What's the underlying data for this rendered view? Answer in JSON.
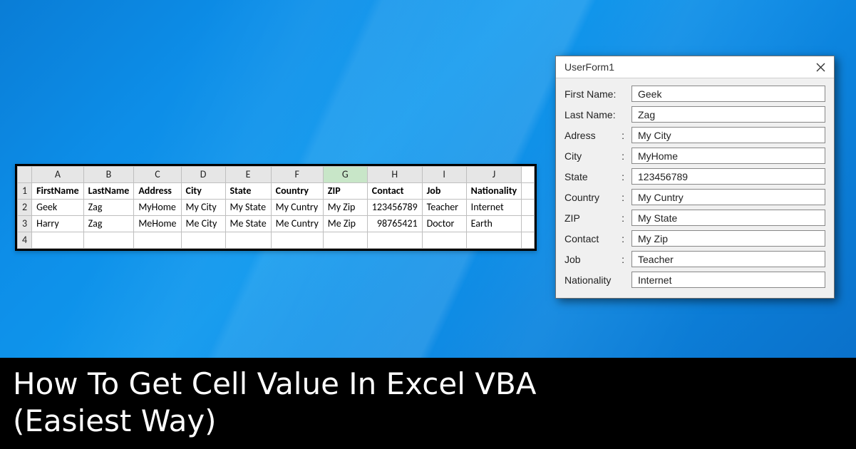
{
  "spreadsheet": {
    "columns": [
      "A",
      "B",
      "C",
      "D",
      "E",
      "F",
      "G",
      "H",
      "I",
      "J"
    ],
    "selectedColumn": "G",
    "headers": [
      "FirstName",
      "LastName",
      "Address",
      "City",
      "State",
      "Country",
      "ZIP",
      "Contact",
      "Job",
      "Nationality"
    ],
    "rows": [
      {
        "num": "2",
        "cells": [
          "Geek",
          "Zag",
          "MyHome",
          "My City",
          "My State",
          "My Cuntry",
          "My Zip",
          "123456789",
          "Teacher",
          "Internet"
        ]
      },
      {
        "num": "3",
        "cells": [
          "Harry",
          "Zag",
          "MeHome",
          "Me City",
          "Me State",
          "Me Cuntry",
          "Me Zip",
          "98765421",
          "Doctor",
          "Earth"
        ]
      }
    ],
    "emptyRow": "4"
  },
  "userform": {
    "title": "UserForm1",
    "fields": [
      {
        "label": "First Name:",
        "value": "Geek",
        "colon": false
      },
      {
        "label": "Last Name:",
        "value": "Zag",
        "colon": false
      },
      {
        "label": "Adress",
        "value": "My City",
        "colon": true
      },
      {
        "label": "City",
        "value": "MyHome",
        "colon": true
      },
      {
        "label": "State",
        "value": "123456789",
        "colon": true
      },
      {
        "label": "Country",
        "value": "My Cuntry",
        "colon": true
      },
      {
        "label": "ZIP",
        "value": "My State",
        "colon": true
      },
      {
        "label": "Contact",
        "value": "My Zip",
        "colon": true
      },
      {
        "label": "Job",
        "value": "Teacher",
        "colon": true
      },
      {
        "label": "Nationality",
        "value": "Internet",
        "colon": false
      }
    ]
  },
  "banner": {
    "line1": "How To Get Cell Value In Excel VBA",
    "line2": "(Easiest Way)"
  }
}
